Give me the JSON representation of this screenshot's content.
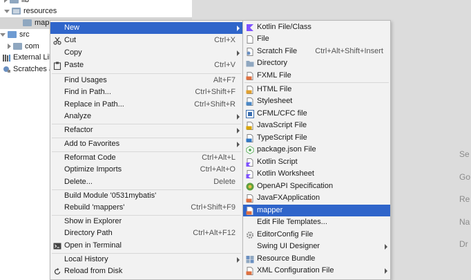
{
  "tree": {
    "rows": [
      {
        "label": "lib",
        "indent": 1,
        "kind": "folder",
        "expanded": false
      },
      {
        "label": "resources",
        "indent": 1,
        "kind": "res",
        "expanded": true
      },
      {
        "label": "mapp",
        "indent": 2,
        "kind": "folder",
        "selected": true
      },
      {
        "label": "src",
        "indent": 0,
        "kind": "src",
        "expanded": true
      },
      {
        "label": "com",
        "indent": 1,
        "kind": "folder",
        "expanded": false
      },
      {
        "label": "External Lib",
        "indent": 0,
        "kind": "lib"
      },
      {
        "label": "Scratches a",
        "indent": 0,
        "kind": "scratch"
      }
    ]
  },
  "context_menu": {
    "items": [
      {
        "label": "New",
        "shortcut": "",
        "submenu": true,
        "highlighted": true,
        "icon": ""
      },
      {
        "label": "Cut",
        "mnemonic": "t",
        "shortcut": "Ctrl+X",
        "icon": "scissors-icon"
      },
      {
        "label": "Copy",
        "shortcut": "",
        "submenu": true,
        "icon": ""
      },
      {
        "label": "Paste",
        "mnemonic": "P",
        "shortcut": "Ctrl+V",
        "icon": "clipboard-icon"
      },
      {
        "sep": true
      },
      {
        "label": "Find Usages",
        "shortcut": "Alt+F7"
      },
      {
        "label": "Find in Path...",
        "shortcut": "Ctrl+Shift+F"
      },
      {
        "label": "Replace in Path...",
        "shortcut": "Ctrl+Shift+R"
      },
      {
        "label": "Analyze",
        "submenu": true
      },
      {
        "sep": true
      },
      {
        "label": "Refactor",
        "submenu": true
      },
      {
        "sep": true
      },
      {
        "label": "Add to Favorites",
        "submenu": true
      },
      {
        "sep": true
      },
      {
        "label": "Reformat Code",
        "shortcut": "Ctrl+Alt+L"
      },
      {
        "label": "Optimize Imports",
        "shortcut": "Ctrl+Alt+O"
      },
      {
        "label": "Delete...",
        "shortcut": "Delete"
      },
      {
        "sep": true
      },
      {
        "label": "Build Module '0531mybatis'",
        "shortcut": ""
      },
      {
        "label": "Rebuild 'mappers'",
        "shortcut": "Ctrl+Shift+F9"
      },
      {
        "sep": true
      },
      {
        "label": "Show in Explorer",
        "shortcut": ""
      },
      {
        "label": "Directory Path",
        "shortcut": "Ctrl+Alt+F12"
      },
      {
        "label": "Open in Terminal",
        "shortcut": "",
        "icon": "terminal-icon"
      },
      {
        "sep": true
      },
      {
        "label": "Local History",
        "submenu": true
      },
      {
        "label": "Reload from Disk",
        "icon": "reload-icon"
      }
    ]
  },
  "submenu": {
    "items": [
      {
        "label": "Kotlin File/Class",
        "icon": "kotlin-icon",
        "color": "#7f52ff"
      },
      {
        "label": "File",
        "icon": "file-icon",
        "color": "#9a9a9a"
      },
      {
        "label": "Scratch File",
        "shortcut": "Ctrl+Alt+Shift+Insert",
        "icon": "scratch-icon",
        "color": "#9a9a9a"
      },
      {
        "label": "Directory",
        "icon": "folder-icon",
        "color": "#8fa7c0"
      },
      {
        "label": "FXML File",
        "icon": "fxml-icon",
        "color": "#e07040"
      },
      {
        "sep": true
      },
      {
        "label": "HTML File",
        "icon": "html-icon",
        "color": "#e0a030"
      },
      {
        "label": "Stylesheet",
        "icon": "css-icon",
        "color": "#4a88c7"
      },
      {
        "label": "CFML/CFC file",
        "icon": "cfml-icon",
        "color": "#3c6fb0"
      },
      {
        "label": "JavaScript File",
        "icon": "js-icon",
        "color": "#d9a400"
      },
      {
        "label": "TypeScript File",
        "icon": "ts-icon",
        "color": "#3178c6"
      },
      {
        "label": "package.json File",
        "icon": "npm-icon",
        "color": "#5faf5f"
      },
      {
        "label": "Kotlin Script",
        "icon": "kotlin-script-icon",
        "color": "#7f52ff"
      },
      {
        "label": "Kotlin Worksheet",
        "icon": "kotlin-worksheet-icon",
        "color": "#7f52ff"
      },
      {
        "label": "OpenAPI Specification",
        "icon": "openapi-icon",
        "color": "#5f9f3f"
      },
      {
        "label": "JavaFXApplication",
        "icon": "javafx-icon",
        "color": "#e07040"
      },
      {
        "label": "mapper",
        "icon": "mapper-icon",
        "color": "#e07040",
        "highlighted": true
      },
      {
        "label": "Edit File Templates...",
        "icon": ""
      },
      {
        "label": "EditorConfig File",
        "icon": "gear-icon",
        "color": "#888888"
      },
      {
        "label": "Swing UI Designer",
        "submenu": true
      },
      {
        "label": "Resource Bundle",
        "icon": "bundle-icon",
        "color": "#6a8fc0"
      },
      {
        "label": "XML Configuration File",
        "icon": "xml-icon",
        "color": "#e07040",
        "submenu": true
      }
    ]
  },
  "editor_hints": [
    "Se",
    "Go",
    "Re",
    "Na",
    "Dr"
  ]
}
